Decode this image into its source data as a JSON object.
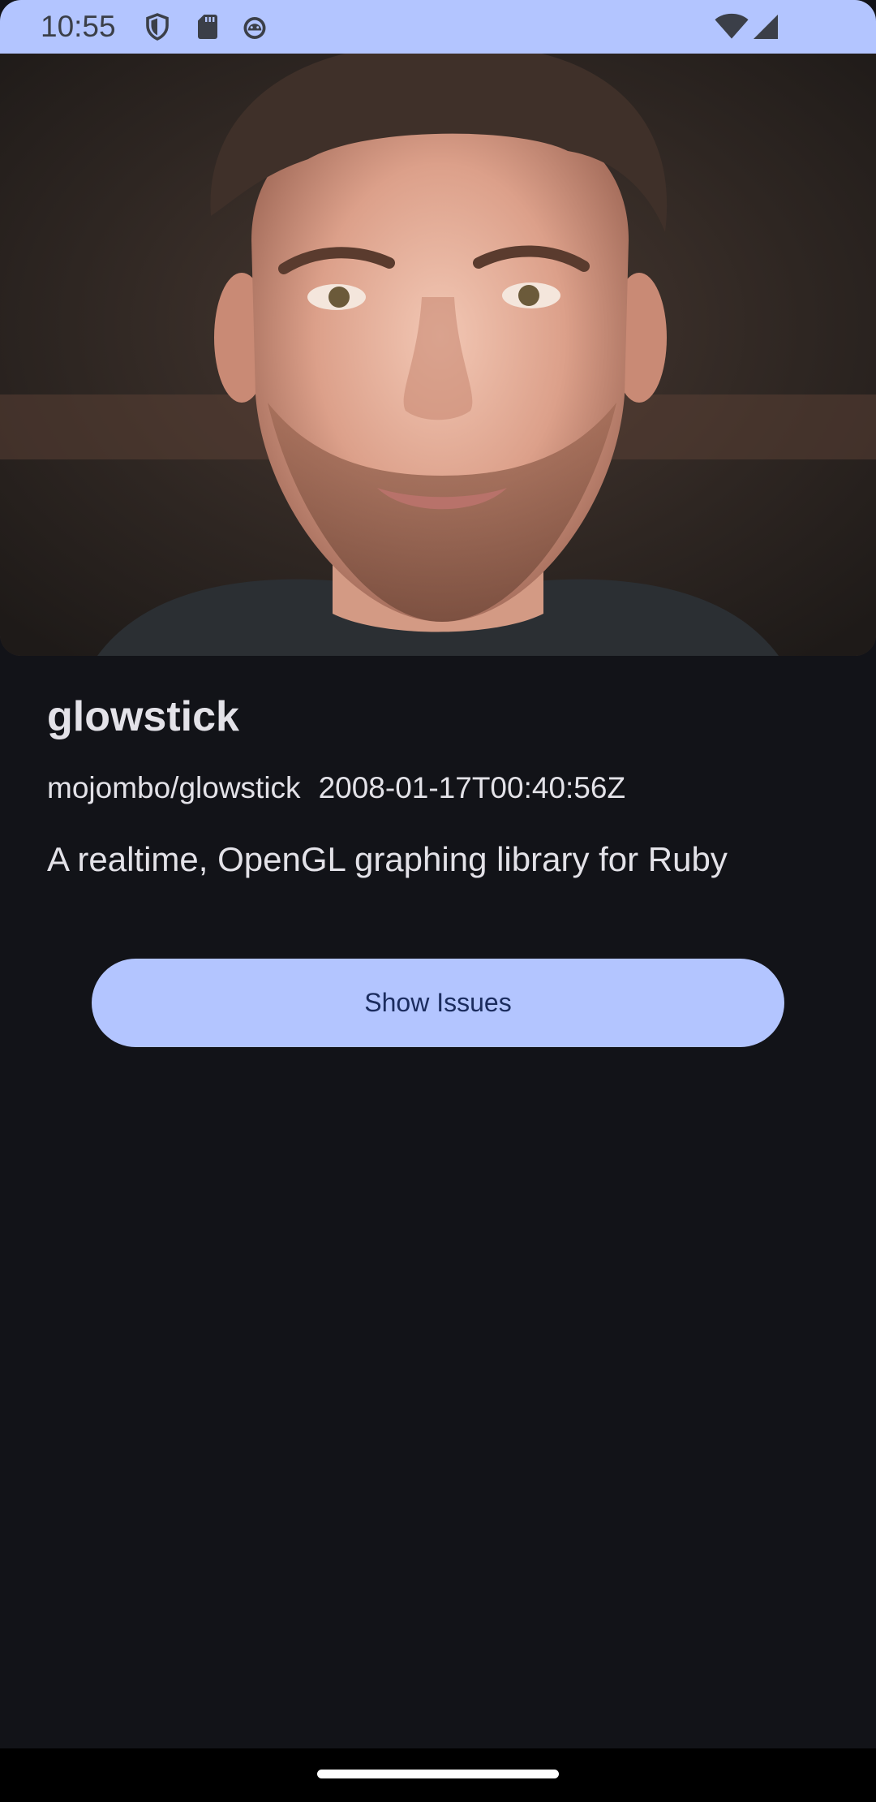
{
  "status_bar": {
    "time": "10:55",
    "icons": [
      "shield-icon",
      "sd-card-icon",
      "android-icon",
      "wifi-icon",
      "cellular-signal-icon"
    ]
  },
  "hero": {
    "image": "repository-owner-avatar-photo"
  },
  "repo": {
    "name": "glowstick",
    "full_name": "mojombo/glowstick",
    "created_at": "2008-01-17T00:40:56Z",
    "description": "A realtime, OpenGL graphing library for Ruby"
  },
  "actions": {
    "show_issues_label": "Show Issues"
  },
  "colors": {
    "background": "#121318",
    "accent": "#b3c5ff",
    "on_accent": "#1b2c5e",
    "text": "#e3e2e8"
  }
}
